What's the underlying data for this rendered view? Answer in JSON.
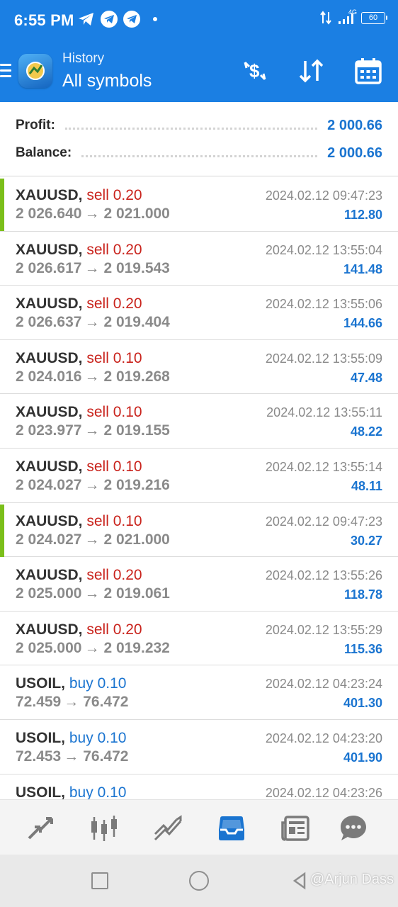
{
  "status_bar": {
    "time": "6:55 PM",
    "network_label": "4G",
    "battery": "60"
  },
  "header": {
    "subtitle": "History",
    "title": "All symbols",
    "menu_icon": "hamburger-icon",
    "actions": [
      {
        "icon": "dollar-refresh-icon"
      },
      {
        "icon": "sort-icon"
      },
      {
        "icon": "calendar-icon"
      }
    ]
  },
  "summary": {
    "profit_label": "Profit:",
    "profit_value": "2 000.66",
    "balance_label": "Balance:",
    "balance_value": "2 000.66"
  },
  "deals": [
    {
      "symbol": "XAUUSD,",
      "side": "sell",
      "volume": "0.20",
      "open": "2 026.640",
      "arrow": "→",
      "close": "2 021.000",
      "time": "2024.02.12 09:47:23",
      "profit": "112.80",
      "marked": true
    },
    {
      "symbol": "XAUUSD,",
      "side": "sell",
      "volume": "0.20",
      "open": "2 026.617",
      "arrow": "→",
      "close": "2 019.543",
      "time": "2024.02.12 13:55:04",
      "profit": "141.48",
      "marked": false
    },
    {
      "symbol": "XAUUSD,",
      "side": "sell",
      "volume": "0.20",
      "open": "2 026.637",
      "arrow": "→",
      "close": "2 019.404",
      "time": "2024.02.12 13:55:06",
      "profit": "144.66",
      "marked": false
    },
    {
      "symbol": "XAUUSD,",
      "side": "sell",
      "volume": "0.10",
      "open": "2 024.016",
      "arrow": "→",
      "close": "2 019.268",
      "time": "2024.02.12 13:55:09",
      "profit": "47.48",
      "marked": false
    },
    {
      "symbol": "XAUUSD,",
      "side": "sell",
      "volume": "0.10",
      "open": "2 023.977",
      "arrow": "→",
      "close": "2 019.155",
      "time": "2024.02.12 13:55:11",
      "profit": "48.22",
      "marked": false
    },
    {
      "symbol": "XAUUSD,",
      "side": "sell",
      "volume": "0.10",
      "open": "2 024.027",
      "arrow": "→",
      "close": "2 019.216",
      "time": "2024.02.12 13:55:14",
      "profit": "48.11",
      "marked": false
    },
    {
      "symbol": "XAUUSD,",
      "side": "sell",
      "volume": "0.10",
      "open": "2 024.027",
      "arrow": "→",
      "close": "2 021.000",
      "time": "2024.02.12 09:47:23",
      "profit": "30.27",
      "marked": true
    },
    {
      "symbol": "XAUUSD,",
      "side": "sell",
      "volume": "0.20",
      "open": "2 025.000",
      "arrow": "→",
      "close": "2 019.061",
      "time": "2024.02.12 13:55:26",
      "profit": "118.78",
      "marked": false
    },
    {
      "symbol": "XAUUSD,",
      "side": "sell",
      "volume": "0.20",
      "open": "2 025.000",
      "arrow": "→",
      "close": "2 019.232",
      "time": "2024.02.12 13:55:29",
      "profit": "115.36",
      "marked": false
    },
    {
      "symbol": "USOIL,",
      "side": "buy",
      "volume": "0.10",
      "open": "72.459",
      "arrow": "→",
      "close": "76.472",
      "time": "2024.02.12 04:23:24",
      "profit": "401.30",
      "marked": false
    },
    {
      "symbol": "USOIL,",
      "side": "buy",
      "volume": "0.10",
      "open": "72.453",
      "arrow": "→",
      "close": "76.472",
      "time": "2024.02.12 04:23:20",
      "profit": "401.90",
      "marked": false
    },
    {
      "symbol": "USOIL,",
      "side": "buy",
      "volume": "0.10",
      "open": "",
      "arrow": "",
      "close": "",
      "time": "2024.02.12 04:23:26",
      "profit": "",
      "marked": false
    }
  ],
  "tabbar": {
    "tabs": [
      {
        "icon": "quotes-arrows-icon",
        "active": false
      },
      {
        "icon": "candlestick-chart-icon",
        "active": false
      },
      {
        "icon": "trade-chart-icon",
        "active": false
      },
      {
        "icon": "history-inbox-icon",
        "active": true
      },
      {
        "icon": "news-icon",
        "active": false
      },
      {
        "icon": "chat-icon",
        "active": false
      }
    ]
  },
  "colors": {
    "header_bg": "#1b7fe3",
    "accent_blue": "#1a74d0",
    "sell_red": "#c9231c",
    "marker_green": "#7bbf1a",
    "price_grey": "#8a8a8a"
  },
  "watermark": "@Arjun Dass"
}
